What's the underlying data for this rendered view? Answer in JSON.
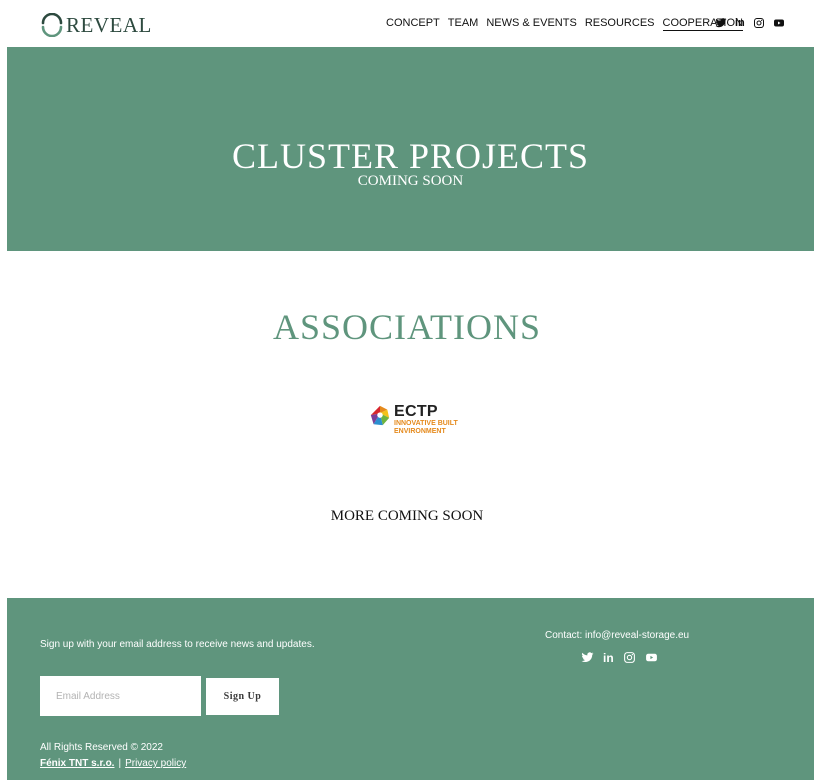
{
  "header": {
    "logo_text": "REVEAL",
    "nav": [
      {
        "label": "CONCEPT"
      },
      {
        "label": "TEAM"
      },
      {
        "label": "NEWS & EVENTS"
      },
      {
        "label": "RESOURCES"
      },
      {
        "label": "COOPERATION",
        "active": true
      }
    ],
    "social": [
      "twitter-icon",
      "linkedin-icon",
      "instagram-icon",
      "youtube-icon"
    ],
    "linkedin_text": "in"
  },
  "hero": {
    "title": "CLUSTER PROJECTS",
    "subtitle": "COMING SOON"
  },
  "associations": {
    "title": "ASSOCIATIONS",
    "logo": {
      "name": "ECTP",
      "tagline_line1": "INNOVATIVE BUILT",
      "tagline_line2": "ENVIRONMENT"
    },
    "more": "MORE COMING SOON"
  },
  "footer": {
    "signup_text": "Sign up with your email address to receive news and updates.",
    "email_placeholder": "Email Address",
    "signup_button": "Sign Up",
    "contact": "Contact: info@reveal-storage.eu",
    "linkedin_text": "in",
    "rights": "All Rights Reserved © 2022",
    "company_link": "Fénix TNT s.r.o.",
    "separator": "|",
    "privacy_link": "Privacy policy"
  },
  "colors": {
    "brand_green": "#5f957d",
    "orange": "#e58a1c"
  }
}
